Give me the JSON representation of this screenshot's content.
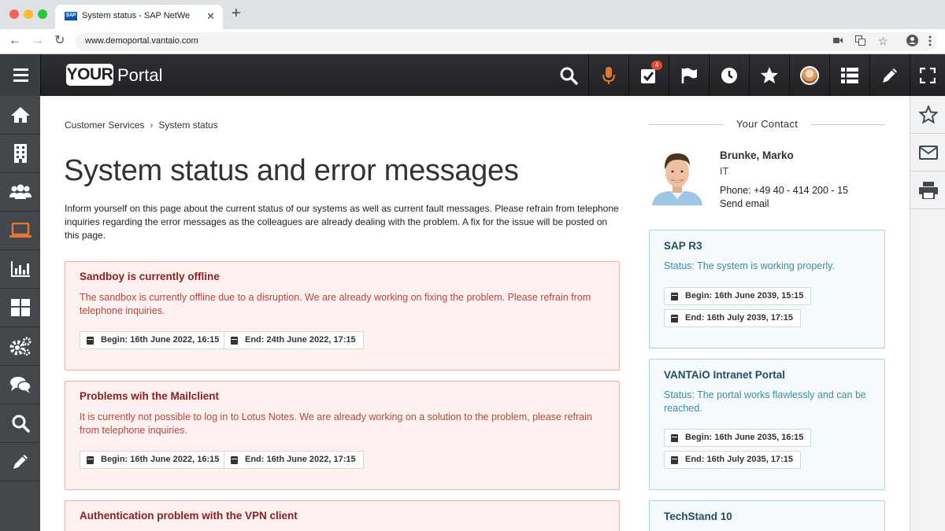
{
  "browser": {
    "tab_title": "System status - SAP NetWe",
    "tab_favicon": "SAP",
    "url": "www.demoportal.vantaio.com"
  },
  "header": {
    "logo_box": "YOUR",
    "logo_text": "Portal",
    "tasks_badge": "4",
    "accent_mic": "#e8772e",
    "icons": [
      "search-icon",
      "microphone-icon",
      "tasks-icon",
      "flag-icon",
      "clock-icon",
      "star-icon",
      "avatar",
      "list-icon",
      "pencil-icon",
      "fullscreen-icon"
    ]
  },
  "sidebar": {
    "items": [
      "home-icon",
      "building-icon",
      "users-icon",
      "laptop-icon",
      "chart-icon",
      "dashboard-icon",
      "settings-icon",
      "chat-icon",
      "search-icon",
      "pencil-icon"
    ],
    "active_item": "laptop-icon",
    "active_color": "#e8772e"
  },
  "right_sidebar": {
    "items": [
      "star-icon",
      "mail-icon",
      "print-icon"
    ]
  },
  "breadcrumb": {
    "parent": "Customer Services",
    "separator": "›",
    "current": "System status"
  },
  "page": {
    "title": "System status and error messages",
    "intro": "Inform yourself on this page about the current status of our systems as well as current fault messages. Please refrain from telephone inquiries regarding the error messages as the colleagues are already dealing with the problem. A fix for the issue will be posted on this page."
  },
  "messages": [
    {
      "title": "Sandboy is currently offline",
      "body": "The sandbox is currently offline due to a disruption. We are already working on fixing the problem. Please refrain from telephone inquiries.",
      "begin": "Begin: 16th June 2022, 16:15",
      "end": "End: 24th June 2022, 17:15"
    },
    {
      "title": "Problems wih the Mailclient",
      "body": "It is currently not possible to log in to Lotus Notes. We are already working on a solution to the problem, please refrain from telephone inquiries.",
      "begin": "Begin: 16th June 2022, 16:15",
      "end": "End: 16th June 2022, 17:15"
    },
    {
      "title": "Authentication problem with the VPN client"
    }
  ],
  "contact": {
    "heading": "Your Contact",
    "name": "Brunke, Marko",
    "department": "IT",
    "phone": "Phone: +49 40 - 414 200 - 15",
    "email_link": "Send email"
  },
  "systems": [
    {
      "name": "SAP R3",
      "status": "Status: The system is working properly.",
      "begin": "Begin: 16th June 2039, 15:15",
      "end": "End: 16th July 2039, 17:15"
    },
    {
      "name": "VANTAiO Intranet Portal",
      "status": "Status: The portal works flawlessly and can be reached.",
      "begin": "Begin: 16th June 2035, 16:15",
      "end": "End: 16th July 2035, 17:15"
    },
    {
      "name": "TechStand 10"
    }
  ]
}
